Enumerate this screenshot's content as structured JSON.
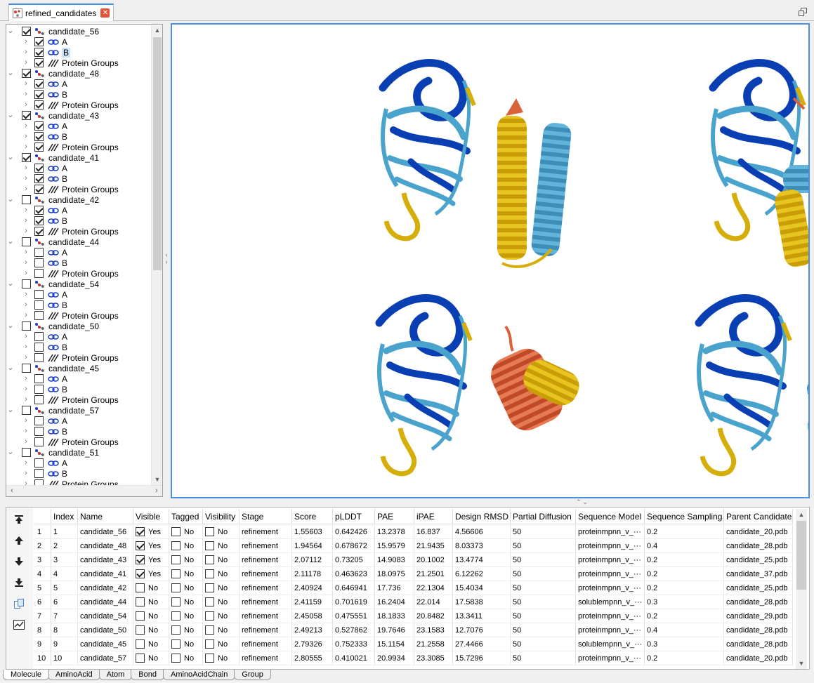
{
  "document_tab": {
    "title": "refined_candidates",
    "close_label": "✕"
  },
  "tree": {
    "candidates": [
      {
        "name": "candidate_56",
        "checked": true,
        "chains": [
          {
            "label": "A",
            "checked": true
          },
          {
            "label": "B",
            "checked": true,
            "highlight": true
          }
        ],
        "group_label": "Protein Groups",
        "group_checked": true
      },
      {
        "name": "candidate_48",
        "checked": true,
        "chains": [
          {
            "label": "A",
            "checked": true
          },
          {
            "label": "B",
            "checked": true
          }
        ],
        "group_label": "Protein Groups",
        "group_checked": true
      },
      {
        "name": "candidate_43",
        "checked": true,
        "chains": [
          {
            "label": "A",
            "checked": true
          },
          {
            "label": "B",
            "checked": true
          }
        ],
        "group_label": "Protein Groups",
        "group_checked": true
      },
      {
        "name": "candidate_41",
        "checked": true,
        "chains": [
          {
            "label": "A",
            "checked": true
          },
          {
            "label": "B",
            "checked": true
          }
        ],
        "group_label": "Protein Groups",
        "group_checked": true
      },
      {
        "name": "candidate_42",
        "checked": false,
        "chains": [
          {
            "label": "A",
            "checked": true
          },
          {
            "label": "B",
            "checked": true
          }
        ],
        "group_label": "Protein Groups",
        "group_checked": true
      },
      {
        "name": "candidate_44",
        "checked": false,
        "chains": [
          {
            "label": "A",
            "checked": false
          },
          {
            "label": "B",
            "checked": false
          }
        ],
        "group_label": "Protein Groups",
        "group_checked": false
      },
      {
        "name": "candidate_54",
        "checked": false,
        "chains": [
          {
            "label": "A",
            "checked": false
          },
          {
            "label": "B",
            "checked": false
          }
        ],
        "group_label": "Protein Groups",
        "group_checked": false
      },
      {
        "name": "candidate_50",
        "checked": false,
        "chains": [
          {
            "label": "A",
            "checked": false
          },
          {
            "label": "B",
            "checked": false
          }
        ],
        "group_label": "Protein Groups",
        "group_checked": false
      },
      {
        "name": "candidate_45",
        "checked": false,
        "chains": [
          {
            "label": "A",
            "checked": false
          },
          {
            "label": "B",
            "checked": false
          }
        ],
        "group_label": "Protein Groups",
        "group_checked": false
      },
      {
        "name": "candidate_57",
        "checked": false,
        "chains": [
          {
            "label": "A",
            "checked": false
          },
          {
            "label": "B",
            "checked": false
          }
        ],
        "group_label": "Protein Groups",
        "group_checked": false
      },
      {
        "name": "candidate_51",
        "checked": false,
        "chains": [
          {
            "label": "A",
            "checked": false
          },
          {
            "label": "B",
            "checked": false
          }
        ],
        "group_label": "Protein Groups",
        "group_checked": false
      }
    ]
  },
  "viewer": {
    "colors": {
      "dark_blue": "#0a3fb4",
      "light_blue": "#4aa3cc",
      "gold": "#d6ae0a",
      "orange": "#d9623a"
    }
  },
  "table": {
    "columns": [
      "Index",
      "Name",
      "Visible",
      "Tagged",
      "Visibility",
      "Stage",
      "Score",
      "pLDDT",
      "PAE",
      "iPAE",
      "Design RMSD",
      "Partial Diffusion",
      "Sequence Model",
      "Sequence Sampling",
      "Parent Candidate"
    ],
    "rows": [
      {
        "num": "1",
        "index": "1",
        "name": "candidate_56",
        "visible": true,
        "visible_text": "Yes",
        "tagged_text": "No",
        "visibility_text": "No",
        "stage": "refinement",
        "score": "1.55603",
        "plddt": "0.642426",
        "pae": "13.2378",
        "ipae": "16.837",
        "rmsd": "4.56606",
        "pd": "50",
        "seqmodel": "proteinmpnn_v_···",
        "sampling": "0.2",
        "parent": "candidate_20.pdb"
      },
      {
        "num": "2",
        "index": "2",
        "name": "candidate_48",
        "visible": true,
        "visible_text": "Yes",
        "tagged_text": "No",
        "visibility_text": "No",
        "stage": "refinement",
        "score": "1.94564",
        "plddt": "0.678672",
        "pae": "15.9579",
        "ipae": "21.9435",
        "rmsd": "8.03373",
        "pd": "50",
        "seqmodel": "proteinmpnn_v_···",
        "sampling": "0.4",
        "parent": "candidate_28.pdb"
      },
      {
        "num": "3",
        "index": "3",
        "name": "candidate_43",
        "visible": true,
        "visible_text": "Yes",
        "tagged_text": "No",
        "visibility_text": "No",
        "stage": "refinement",
        "score": "2.07112",
        "plddt": "0.73205",
        "pae": "14.9083",
        "ipae": "20.1002",
        "rmsd": "13.4774",
        "pd": "50",
        "seqmodel": "proteinmpnn_v_···",
        "sampling": "0.2",
        "parent": "candidate_25.pdb"
      },
      {
        "num": "4",
        "index": "4",
        "name": "candidate_41",
        "visible": true,
        "visible_text": "Yes",
        "tagged_text": "No",
        "visibility_text": "No",
        "stage": "refinement",
        "score": "2.11178",
        "plddt": "0.463623",
        "pae": "18.0975",
        "ipae": "21.2501",
        "rmsd": "6.12262",
        "pd": "50",
        "seqmodel": "proteinmpnn_v_···",
        "sampling": "0.2",
        "parent": "candidate_37.pdb"
      },
      {
        "num": "5",
        "index": "5",
        "name": "candidate_42",
        "visible": false,
        "visible_text": "No",
        "tagged_text": "No",
        "visibility_text": "No",
        "stage": "refinement",
        "score": "2.40924",
        "plddt": "0.646941",
        "pae": "17.736",
        "ipae": "22.1304",
        "rmsd": "15.4034",
        "pd": "50",
        "seqmodel": "proteinmpnn_v_···",
        "sampling": "0.2",
        "parent": "candidate_25.pdb"
      },
      {
        "num": "6",
        "index": "6",
        "name": "candidate_44",
        "visible": false,
        "visible_text": "No",
        "tagged_text": "No",
        "visibility_text": "No",
        "stage": "refinement",
        "score": "2.41159",
        "plddt": "0.701619",
        "pae": "16.2404",
        "ipae": "22.014",
        "rmsd": "17.5838",
        "pd": "50",
        "seqmodel": "solublempnn_v_···",
        "sampling": "0.3",
        "parent": "candidate_28.pdb"
      },
      {
        "num": "7",
        "index": "7",
        "name": "candidate_54",
        "visible": false,
        "visible_text": "No",
        "tagged_text": "No",
        "visibility_text": "No",
        "stage": "refinement",
        "score": "2.45058",
        "plddt": "0.475551",
        "pae": "18.1833",
        "ipae": "20.8482",
        "rmsd": "13.3411",
        "pd": "50",
        "seqmodel": "proteinmpnn_v_···",
        "sampling": "0.2",
        "parent": "candidate_29.pdb"
      },
      {
        "num": "8",
        "index": "8",
        "name": "candidate_50",
        "visible": false,
        "visible_text": "No",
        "tagged_text": "No",
        "visibility_text": "No",
        "stage": "refinement",
        "score": "2.49213",
        "plddt": "0.527862",
        "pae": "19.7646",
        "ipae": "23.1583",
        "rmsd": "12.7076",
        "pd": "50",
        "seqmodel": "proteinmpnn_v_···",
        "sampling": "0.4",
        "parent": "candidate_28.pdb"
      },
      {
        "num": "9",
        "index": "9",
        "name": "candidate_45",
        "visible": false,
        "visible_text": "No",
        "tagged_text": "No",
        "visibility_text": "No",
        "stage": "refinement",
        "score": "2.79326",
        "plddt": "0.752333",
        "pae": "15.1154",
        "ipae": "21.2558",
        "rmsd": "27.4466",
        "pd": "50",
        "seqmodel": "solublempnn_v_···",
        "sampling": "0.3",
        "parent": "candidate_28.pdb"
      },
      {
        "num": "10",
        "index": "10",
        "name": "candidate_57",
        "visible": false,
        "visible_text": "No",
        "tagged_text": "No",
        "visibility_text": "No",
        "stage": "refinement",
        "score": "2.80555",
        "plddt": "0.410021",
        "pae": "20.9934",
        "ipae": "23.3085",
        "rmsd": "15.7296",
        "pd": "50",
        "seqmodel": "proteinmpnn_v_···",
        "sampling": "0.2",
        "parent": "candidate_20.pdb"
      }
    ]
  },
  "bottom_tabs": [
    "Molecule",
    "AminoAcid",
    "Atom",
    "Bond",
    "AminoAcidChain",
    "Group"
  ]
}
